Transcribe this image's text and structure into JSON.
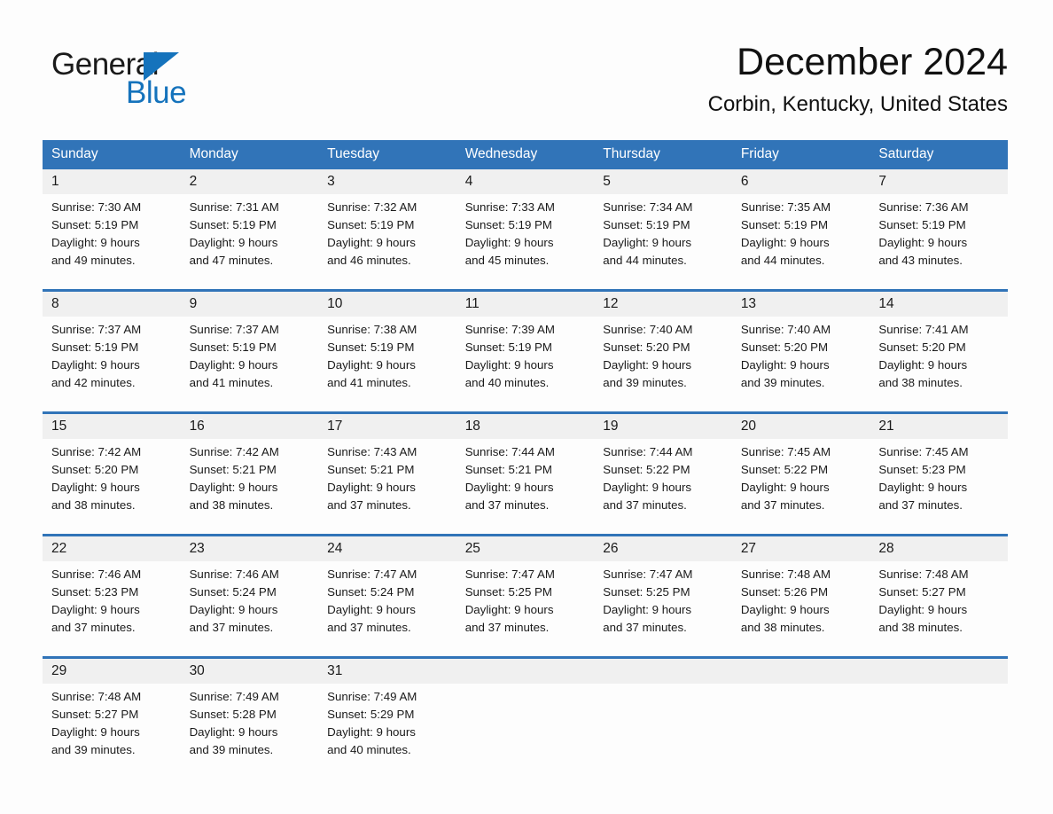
{
  "brand": {
    "name_part1": "General",
    "name_part2": "Blue",
    "color_primary": "#1573bc"
  },
  "header": {
    "title": "December 2024",
    "subtitle": "Corbin, Kentucky, United States"
  },
  "theme": {
    "header_blue": "#3174b8",
    "date_band": "#f0f0f0",
    "page_bg": "#fdfdfd"
  },
  "weekdays": [
    "Sunday",
    "Monday",
    "Tuesday",
    "Wednesday",
    "Thursday",
    "Friday",
    "Saturday"
  ],
  "weeks": [
    [
      {
        "day": "1",
        "sunrise": "Sunrise: 7:30 AM",
        "sunset": "Sunset: 5:19 PM",
        "daylight1": "Daylight: 9 hours",
        "daylight2": "and 49 minutes."
      },
      {
        "day": "2",
        "sunrise": "Sunrise: 7:31 AM",
        "sunset": "Sunset: 5:19 PM",
        "daylight1": "Daylight: 9 hours",
        "daylight2": "and 47 minutes."
      },
      {
        "day": "3",
        "sunrise": "Sunrise: 7:32 AM",
        "sunset": "Sunset: 5:19 PM",
        "daylight1": "Daylight: 9 hours",
        "daylight2": "and 46 minutes."
      },
      {
        "day": "4",
        "sunrise": "Sunrise: 7:33 AM",
        "sunset": "Sunset: 5:19 PM",
        "daylight1": "Daylight: 9 hours",
        "daylight2": "and 45 minutes."
      },
      {
        "day": "5",
        "sunrise": "Sunrise: 7:34 AM",
        "sunset": "Sunset: 5:19 PM",
        "daylight1": "Daylight: 9 hours",
        "daylight2": "and 44 minutes."
      },
      {
        "day": "6",
        "sunrise": "Sunrise: 7:35 AM",
        "sunset": "Sunset: 5:19 PM",
        "daylight1": "Daylight: 9 hours",
        "daylight2": "and 44 minutes."
      },
      {
        "day": "7",
        "sunrise": "Sunrise: 7:36 AM",
        "sunset": "Sunset: 5:19 PM",
        "daylight1": "Daylight: 9 hours",
        "daylight2": "and 43 minutes."
      }
    ],
    [
      {
        "day": "8",
        "sunrise": "Sunrise: 7:37 AM",
        "sunset": "Sunset: 5:19 PM",
        "daylight1": "Daylight: 9 hours",
        "daylight2": "and 42 minutes."
      },
      {
        "day": "9",
        "sunrise": "Sunrise: 7:37 AM",
        "sunset": "Sunset: 5:19 PM",
        "daylight1": "Daylight: 9 hours",
        "daylight2": "and 41 minutes."
      },
      {
        "day": "10",
        "sunrise": "Sunrise: 7:38 AM",
        "sunset": "Sunset: 5:19 PM",
        "daylight1": "Daylight: 9 hours",
        "daylight2": "and 41 minutes."
      },
      {
        "day": "11",
        "sunrise": "Sunrise: 7:39 AM",
        "sunset": "Sunset: 5:19 PM",
        "daylight1": "Daylight: 9 hours",
        "daylight2": "and 40 minutes."
      },
      {
        "day": "12",
        "sunrise": "Sunrise: 7:40 AM",
        "sunset": "Sunset: 5:20 PM",
        "daylight1": "Daylight: 9 hours",
        "daylight2": "and 39 minutes."
      },
      {
        "day": "13",
        "sunrise": "Sunrise: 7:40 AM",
        "sunset": "Sunset: 5:20 PM",
        "daylight1": "Daylight: 9 hours",
        "daylight2": "and 39 minutes."
      },
      {
        "day": "14",
        "sunrise": "Sunrise: 7:41 AM",
        "sunset": "Sunset: 5:20 PM",
        "daylight1": "Daylight: 9 hours",
        "daylight2": "and 38 minutes."
      }
    ],
    [
      {
        "day": "15",
        "sunrise": "Sunrise: 7:42 AM",
        "sunset": "Sunset: 5:20 PM",
        "daylight1": "Daylight: 9 hours",
        "daylight2": "and 38 minutes."
      },
      {
        "day": "16",
        "sunrise": "Sunrise: 7:42 AM",
        "sunset": "Sunset: 5:21 PM",
        "daylight1": "Daylight: 9 hours",
        "daylight2": "and 38 minutes."
      },
      {
        "day": "17",
        "sunrise": "Sunrise: 7:43 AM",
        "sunset": "Sunset: 5:21 PM",
        "daylight1": "Daylight: 9 hours",
        "daylight2": "and 37 minutes."
      },
      {
        "day": "18",
        "sunrise": "Sunrise: 7:44 AM",
        "sunset": "Sunset: 5:21 PM",
        "daylight1": "Daylight: 9 hours",
        "daylight2": "and 37 minutes."
      },
      {
        "day": "19",
        "sunrise": "Sunrise: 7:44 AM",
        "sunset": "Sunset: 5:22 PM",
        "daylight1": "Daylight: 9 hours",
        "daylight2": "and 37 minutes."
      },
      {
        "day": "20",
        "sunrise": "Sunrise: 7:45 AM",
        "sunset": "Sunset: 5:22 PM",
        "daylight1": "Daylight: 9 hours",
        "daylight2": "and 37 minutes."
      },
      {
        "day": "21",
        "sunrise": "Sunrise: 7:45 AM",
        "sunset": "Sunset: 5:23 PM",
        "daylight1": "Daylight: 9 hours",
        "daylight2": "and 37 minutes."
      }
    ],
    [
      {
        "day": "22",
        "sunrise": "Sunrise: 7:46 AM",
        "sunset": "Sunset: 5:23 PM",
        "daylight1": "Daylight: 9 hours",
        "daylight2": "and 37 minutes."
      },
      {
        "day": "23",
        "sunrise": "Sunrise: 7:46 AM",
        "sunset": "Sunset: 5:24 PM",
        "daylight1": "Daylight: 9 hours",
        "daylight2": "and 37 minutes."
      },
      {
        "day": "24",
        "sunrise": "Sunrise: 7:47 AM",
        "sunset": "Sunset: 5:24 PM",
        "daylight1": "Daylight: 9 hours",
        "daylight2": "and 37 minutes."
      },
      {
        "day": "25",
        "sunrise": "Sunrise: 7:47 AM",
        "sunset": "Sunset: 5:25 PM",
        "daylight1": "Daylight: 9 hours",
        "daylight2": "and 37 minutes."
      },
      {
        "day": "26",
        "sunrise": "Sunrise: 7:47 AM",
        "sunset": "Sunset: 5:25 PM",
        "daylight1": "Daylight: 9 hours",
        "daylight2": "and 37 minutes."
      },
      {
        "day": "27",
        "sunrise": "Sunrise: 7:48 AM",
        "sunset": "Sunset: 5:26 PM",
        "daylight1": "Daylight: 9 hours",
        "daylight2": "and 38 minutes."
      },
      {
        "day": "28",
        "sunrise": "Sunrise: 7:48 AM",
        "sunset": "Sunset: 5:27 PM",
        "daylight1": "Daylight: 9 hours",
        "daylight2": "and 38 minutes."
      }
    ],
    [
      {
        "day": "29",
        "sunrise": "Sunrise: 7:48 AM",
        "sunset": "Sunset: 5:27 PM",
        "daylight1": "Daylight: 9 hours",
        "daylight2": "and 39 minutes."
      },
      {
        "day": "30",
        "sunrise": "Sunrise: 7:49 AM",
        "sunset": "Sunset: 5:28 PM",
        "daylight1": "Daylight: 9 hours",
        "daylight2": "and 39 minutes."
      },
      {
        "day": "31",
        "sunrise": "Sunrise: 7:49 AM",
        "sunset": "Sunset: 5:29 PM",
        "daylight1": "Daylight: 9 hours",
        "daylight2": "and 40 minutes."
      },
      {
        "day": "",
        "sunrise": "",
        "sunset": "",
        "daylight1": "",
        "daylight2": ""
      },
      {
        "day": "",
        "sunrise": "",
        "sunset": "",
        "daylight1": "",
        "daylight2": ""
      },
      {
        "day": "",
        "sunrise": "",
        "sunset": "",
        "daylight1": "",
        "daylight2": ""
      },
      {
        "day": "",
        "sunrise": "",
        "sunset": "",
        "daylight1": "",
        "daylight2": ""
      }
    ]
  ]
}
